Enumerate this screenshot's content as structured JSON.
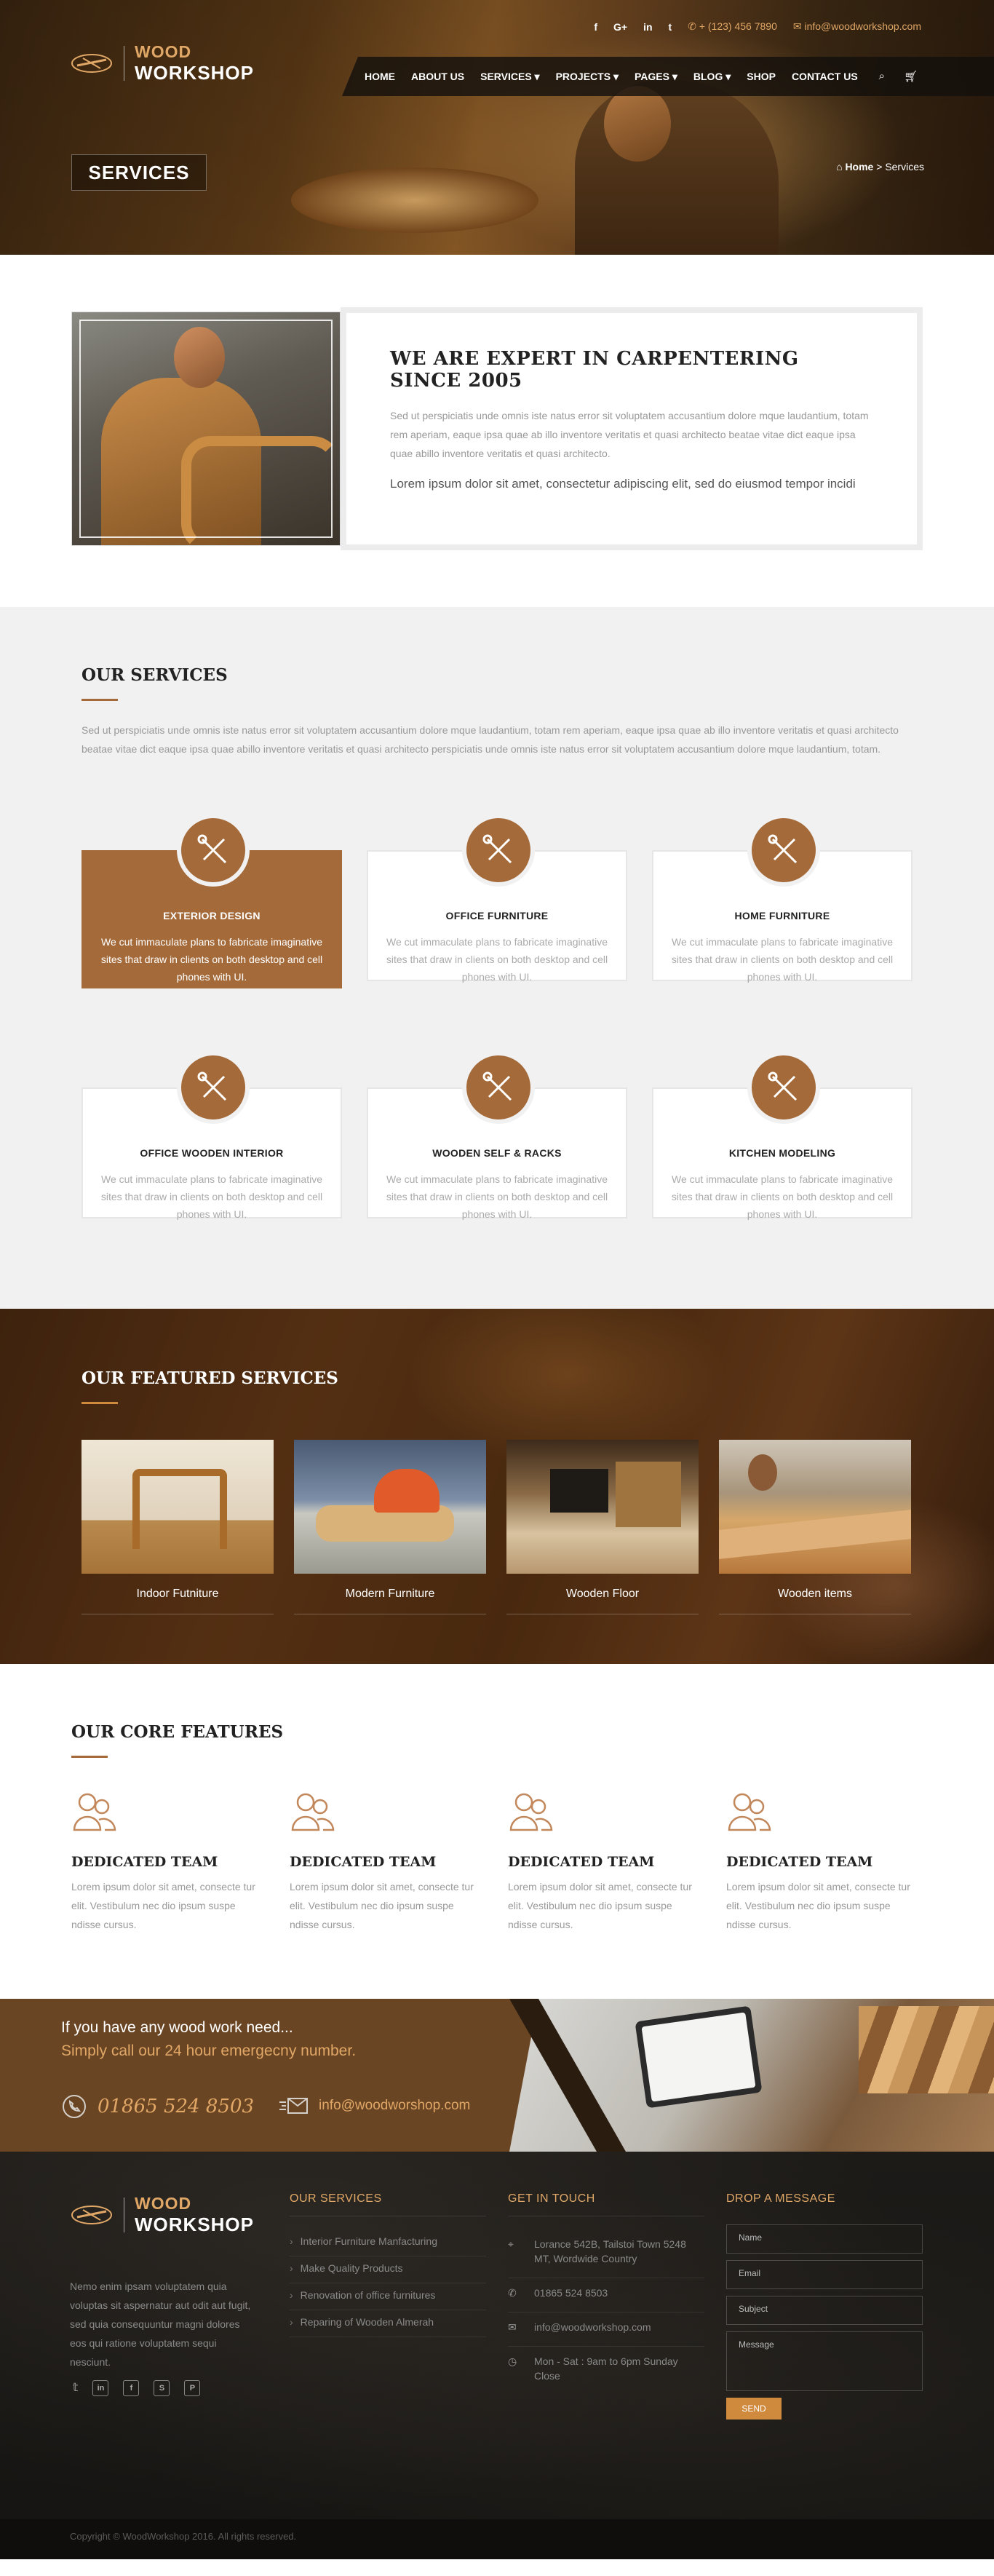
{
  "brand": {
    "line1": "WOOD",
    "line2": "WORKSHOP"
  },
  "topbar": {
    "social": [
      "f",
      "G+",
      "in",
      "t"
    ],
    "phone": "+ (123) 456 7890",
    "email": "info@woodworkshop.com"
  },
  "nav": {
    "items": [
      "HOME",
      "ABOUT US",
      "SERVICES ▾",
      "PROJECTS ▾",
      "PAGES ▾",
      "BLOG ▾",
      "SHOP",
      "CONTACT US"
    ],
    "icons": [
      "search-icon",
      "cart-icon"
    ]
  },
  "banner": {
    "title": "SERVICES",
    "crumb_home": "Home",
    "crumb_sep": " > ",
    "crumb_current": "Services"
  },
  "about": {
    "heading": "WE ARE EXPERT IN CARPENTERING SINCE 2005",
    "text": "Sed ut perspiciatis unde omnis iste natus error sit voluptatem accusantium dolore mque laudantium, totam rem aperiam, eaque ipsa quae ab illo inventore veritatis et quasi architecto beatae vitae dict eaque ipsa quae abillo inventore veritatis et quasi architecto.",
    "lead": "Lorem ipsum dolor sit amet, consectetur adipiscing elit, sed do eiusmod tempor incidi"
  },
  "services": {
    "heading": "OUR SERVICES",
    "intro": "Sed ut perspiciatis unde omnis iste natus error sit voluptatem accusantium dolore mque laudantium, totam rem aperiam, eaque ipsa quae ab illo inventore veritatis et quasi architecto beatae vitae dict eaque ipsa quae abillo inventore veritatis et quasi architecto perspiciatis unde omnis iste natus error sit voluptatem accusantium dolore mque laudantium, totam.",
    "items": [
      {
        "title": "EXTERIOR DESIGN",
        "desc": "We cut immaculate plans to fabricate imaginative sites that draw in clients on both desktop and cell phones with UI."
      },
      {
        "title": "OFFICE FURNITURE",
        "desc": "We cut immaculate plans to fabricate imaginative sites that draw in clients on both desktop and cell phones with UI."
      },
      {
        "title": "HOME FURNITURE",
        "desc": "We cut immaculate plans to fabricate imaginative sites that draw in clients on both desktop and cell phones with UI."
      },
      {
        "title": "OFFICE WOODEN INTERIOR",
        "desc": "We cut immaculate plans to fabricate imaginative sites that draw in clients on both desktop and cell phones with UI."
      },
      {
        "title": "WOODEN SELF & RACKS",
        "desc": "We cut immaculate plans to fabricate imaginative sites that draw in clients on both desktop and cell phones with UI."
      },
      {
        "title": "KITCHEN MODELING",
        "desc": "We cut immaculate plans to fabricate imaginative sites that draw in clients on both desktop and cell phones with UI."
      }
    ]
  },
  "featured": {
    "heading": "OUR FEATURED SERVICES",
    "items": [
      "Indoor Futniture",
      "Modern Furniture",
      "Wooden Floor",
      "Wooden items"
    ]
  },
  "core": {
    "heading": "OUR CORE FEATURES",
    "items": [
      {
        "title": "DEDICATED TEAM",
        "desc": "Lorem ipsum dolor sit amet, consecte tur elit. Vestibulum nec dio ipsum suspe ndisse cursus."
      },
      {
        "title": "DEDICATED TEAM",
        "desc": "Lorem ipsum dolor sit amet, consecte tur elit. Vestibulum nec dio ipsum suspe ndisse cursus."
      },
      {
        "title": "DEDICATED TEAM",
        "desc": "Lorem ipsum dolor sit amet, consecte tur elit. Vestibulum nec dio ipsum suspe ndisse cursus."
      },
      {
        "title": "DEDICATED TEAM",
        "desc": "Lorem ipsum dolor sit amet, consecte tur elit. Vestibulum nec dio ipsum suspe ndisse cursus."
      }
    ]
  },
  "cta": {
    "line1": "If you have any wood work need...",
    "line2": "Simply call our 24 hour emergecny number.",
    "phone": "01865 524 8503",
    "email": "info@woodworshop.com"
  },
  "footer": {
    "about": "Nemo enim ipsam voluptatem quia voluptas sit aspernatur aut odit aut fugit, sed quia consequuntur magni dolores eos qui ratione voluptatem sequi nesciunt.",
    "social": [
      "twitter-icon",
      "linkedin-icon",
      "facebook-icon",
      "skype-icon",
      "pinterest-icon"
    ],
    "services_heading": "OUR SERVICES",
    "services": [
      "Interior Furniture Manfacturing",
      "Make Quality Products",
      "Renovation of office furnitures",
      "Reparing of Wooden Almerah"
    ],
    "contact_heading": "GET IN TOUCH",
    "address": "Lorance 542B, Tailstoi Town 5248 MT, Wordwide Country",
    "phone": "01865 524 8503",
    "email": "info@woodworkshop.com",
    "hours": "Mon - Sat : 9am to 6pm Sunday Close",
    "form_heading": "DROP A MESSAGE",
    "form": {
      "name": "Name",
      "email": "Email",
      "subject": "Subject",
      "message": "Message",
      "send": "SEND"
    },
    "copyright": "Copyright © WoodWorkshop 2016. All rights reserved."
  },
  "colors": {
    "accent": "#a56a39",
    "gold": "#e0a766",
    "footer": "#1d1b18"
  }
}
